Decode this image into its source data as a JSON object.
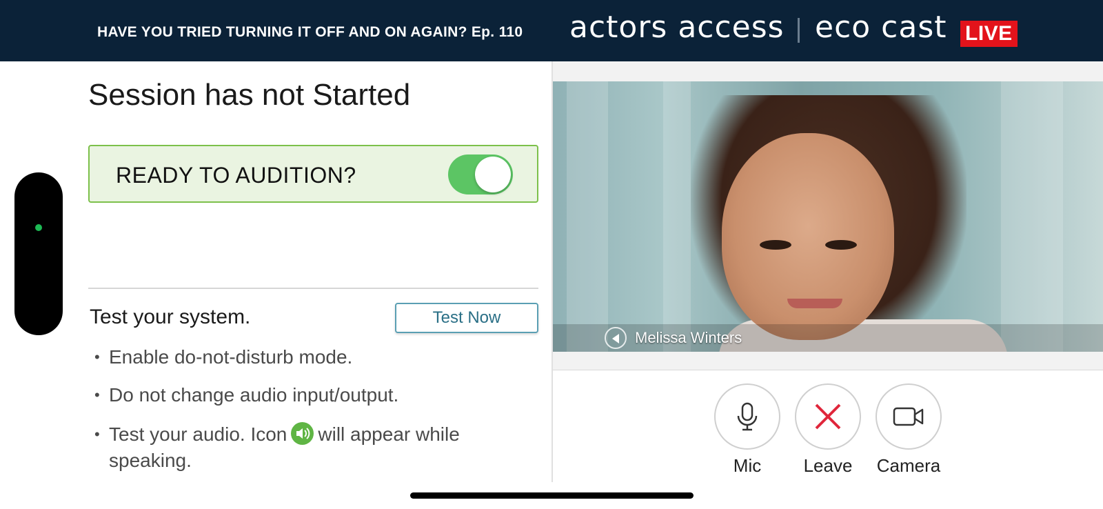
{
  "header": {
    "episode_text": "HAVE YOU TRIED TURNING IT OFF AND ON AGAIN? Ep. 110",
    "brand_left": "actors access",
    "brand_right": "eco cast",
    "live_badge": "LIVE",
    "background_color": "#0b2238",
    "live_color": "#e3131b"
  },
  "session": {
    "title": "Session has not Started",
    "ready_label": "READY TO AUDITION?",
    "ready_toggle_on": true
  },
  "system_test": {
    "title": "Test your system.",
    "button_label": "Test Now",
    "instructions": [
      "Enable do-not-disturb mode.",
      "Do not change audio input/output.",
      "Test your audio. Icon",
      "will appear while speaking."
    ],
    "speaking_icon": "speaker-icon"
  },
  "video": {
    "participant_name": "Melissa Winters",
    "audio_icon": "volume-icon"
  },
  "controls": {
    "mic_label": "Mic",
    "leave_label": "Leave",
    "camera_label": "Camera"
  }
}
